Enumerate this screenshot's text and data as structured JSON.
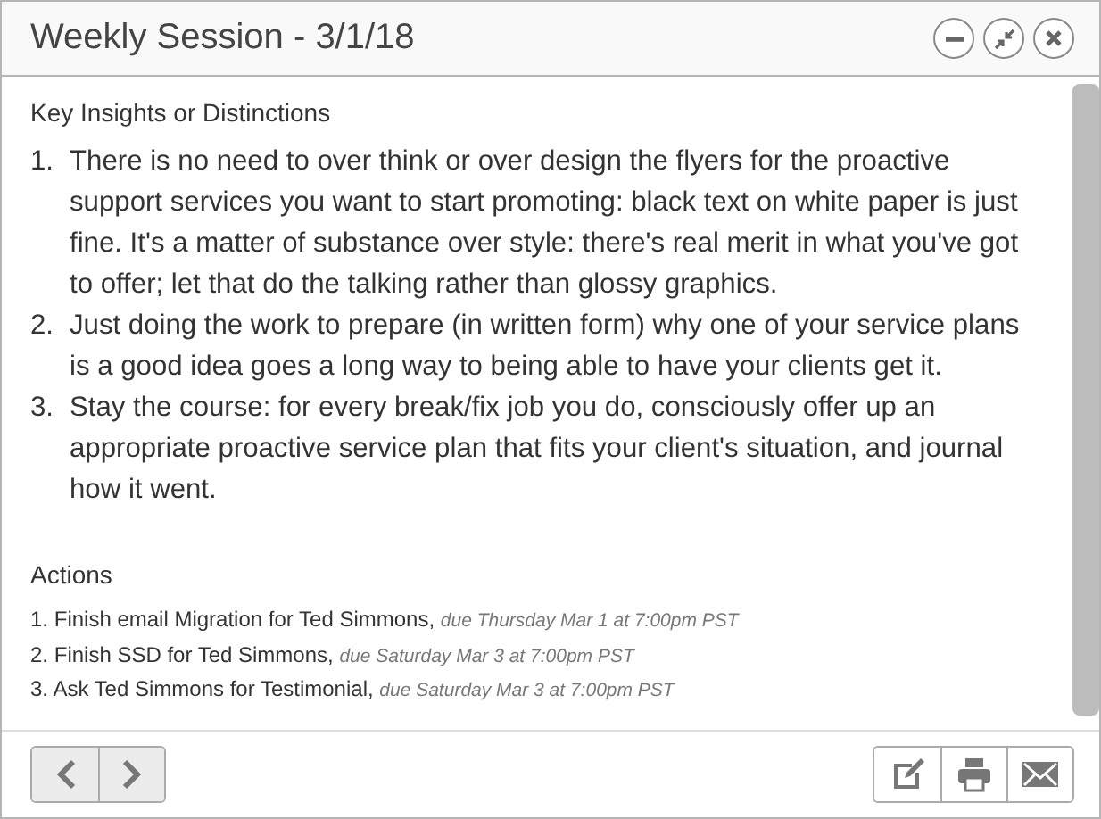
{
  "window": {
    "title": "Weekly Session - 3/1/18"
  },
  "insights": {
    "heading": "Key Insights or Distinctions",
    "items": [
      {
        "number": "1.",
        "text": "There is no need to over think or over design the flyers for the proactive support services you want to start promoting: black text on white paper is just fine. It's a matter of substance over style: there's real merit in what you've got to offer; let that do the talking rather than glossy graphics."
      },
      {
        "number": "2.",
        "text": "Just doing the work to prepare (in written form) why one of your service plans is a good idea goes a long way to being able to have your clients get it."
      },
      {
        "number": "3.",
        "text": "Stay the course: for every break/fix job you do, consciously offer up an appropriate proactive service plan that fits your client's situation, and journal how it went."
      }
    ]
  },
  "actions": {
    "heading": "Actions",
    "items": [
      {
        "number": "1.",
        "task": "Finish email Migration for Ted Simmons,",
        "due": "due Thursday Mar 1 at 7:00pm PST"
      },
      {
        "number": "2.",
        "task": "Finish SSD for Ted Simmons,",
        "due": "due Saturday Mar 3 at 7:00pm PST"
      },
      {
        "number": "3.",
        "task": "Ask Ted Simmons for Testimonial,",
        "due": "due Saturday Mar 3 at 7:00pm PST"
      }
    ]
  }
}
